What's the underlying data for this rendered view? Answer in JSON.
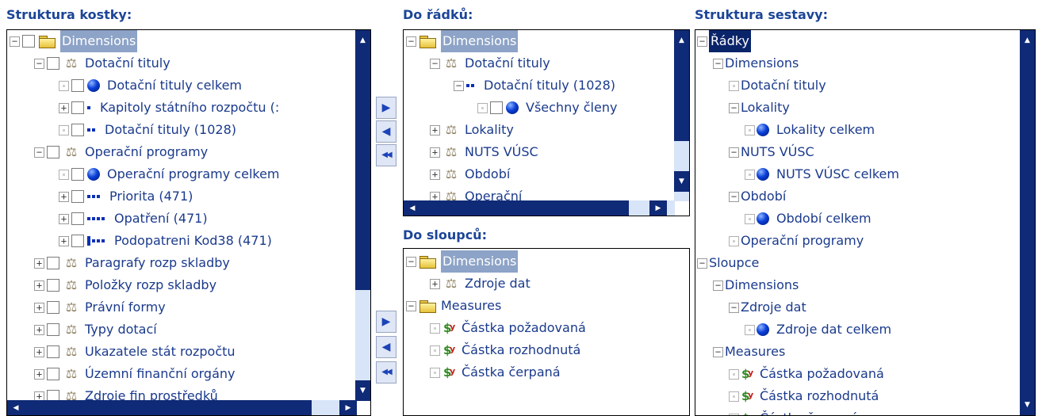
{
  "headers": {
    "cube": "Struktura kostky:",
    "rows": "Do řádků:",
    "cols": "Do sloupců:",
    "report": "Struktura sestavy:"
  },
  "cube_tree": [
    {
      "toggle": "⊟",
      "check": true,
      "icon": "folder",
      "label": "Dimensions",
      "selected": true
    },
    {
      "toggle": "⊟",
      "check": true,
      "icon": "dimension",
      "label": "Dotační tituly"
    },
    {
      "toggle": "dot",
      "check": true,
      "icon": "member-ball",
      "label": "Dotační tituly celkem"
    },
    {
      "toggle": "⊞",
      "check": true,
      "icon": "level-1",
      "label": "Kapitoly státního rozpočtu (:"
    },
    {
      "toggle": "dot",
      "check": true,
      "icon": "level-2",
      "label": "Dotační tituly (1028)"
    },
    {
      "toggle": "⊟",
      "check": true,
      "icon": "dimension",
      "label": "Operační programy"
    },
    {
      "toggle": "dot",
      "check": true,
      "icon": "member-ball",
      "label": "Operační programy celkem"
    },
    {
      "toggle": "⊞",
      "check": true,
      "icon": "level-3",
      "label": "Priorita (471)"
    },
    {
      "toggle": "⊞",
      "check": true,
      "icon": "level-4",
      "label": "Opatření (471)"
    },
    {
      "toggle": "⊞",
      "check": true,
      "icon": "level-podo",
      "label": "Podopatreni Kod38 (471)"
    },
    {
      "toggle": "⊞",
      "check": true,
      "icon": "dimension",
      "label": "Paragrafy rozp skladby"
    },
    {
      "toggle": "⊞",
      "check": true,
      "icon": "dimension",
      "label": "Položky rozp skladby"
    },
    {
      "toggle": "⊞",
      "check": true,
      "icon": "dimension",
      "label": "Právní formy"
    },
    {
      "toggle": "⊞",
      "check": true,
      "icon": "dimension",
      "label": "Typy dotací"
    },
    {
      "toggle": "⊞",
      "check": true,
      "icon": "dimension",
      "label": "Ukazatele stát rozpočtu"
    },
    {
      "toggle": "⊞",
      "check": true,
      "icon": "dimension",
      "label": "Územní finanční orgány"
    },
    {
      "toggle": "⊞",
      "check": true,
      "icon": "dimension",
      "label": "Zdroje fin prostředků"
    }
  ],
  "rows_tree": [
    {
      "toggle": "⊟",
      "check": false,
      "icon": "folder",
      "label": "Dimensions",
      "selected": true
    },
    {
      "toggle": "⊟",
      "check": false,
      "icon": "dimension",
      "label": "Dotační tituly"
    },
    {
      "toggle": "⊟",
      "check": false,
      "icon": "level-2",
      "label": "Dotační tituly (1028)"
    },
    {
      "toggle": "dot",
      "check": true,
      "icon": "member-ball",
      "label": "Všechny členy"
    },
    {
      "toggle": "⊞",
      "check": false,
      "icon": "dimension",
      "label": "Lokality"
    },
    {
      "toggle": "⊞",
      "check": false,
      "icon": "dimension",
      "label": "NUTS VÚSC"
    },
    {
      "toggle": "⊞",
      "check": false,
      "icon": "dimension",
      "label": "Období"
    },
    {
      "toggle": "⊞",
      "check": false,
      "icon": "dimension",
      "label": "Operační"
    }
  ],
  "cols_tree": [
    {
      "toggle": "⊟",
      "check": false,
      "icon": "folder",
      "label": "Dimensions",
      "selected": true
    },
    {
      "toggle": "⊞",
      "check": false,
      "icon": "dimension",
      "label": "Zdroje dat"
    },
    {
      "toggle": "⊟",
      "check": false,
      "icon": "folder",
      "label": "Measures"
    },
    {
      "toggle": "dot",
      "check": false,
      "icon": "measure",
      "label": "Částka požadovaná"
    },
    {
      "toggle": "dot",
      "check": false,
      "icon": "measure",
      "label": "Částka rozhodnutá"
    },
    {
      "toggle": "dot",
      "check": false,
      "icon": "measure",
      "label": "Částka čerpaná"
    }
  ],
  "report_tree": [
    {
      "toggle": "⊟",
      "icon": "",
      "label": "Řádky",
      "selected_dark": true
    },
    {
      "toggle": "⊟",
      "icon": "",
      "label": "Dimensions"
    },
    {
      "toggle": "dot",
      "icon": "",
      "label": "Dotační tituly"
    },
    {
      "toggle": "⊟",
      "icon": "",
      "label": "Lokality"
    },
    {
      "toggle": "dot",
      "icon": "member-ball",
      "label": "Lokality celkem"
    },
    {
      "toggle": "⊟",
      "icon": "",
      "label": "NUTS VÚSC"
    },
    {
      "toggle": "dot",
      "icon": "member-ball",
      "label": "NUTS VÚSC celkem"
    },
    {
      "toggle": "⊟",
      "icon": "",
      "label": "Období"
    },
    {
      "toggle": "dot",
      "icon": "member-ball",
      "label": "Období celkem"
    },
    {
      "toggle": "dot",
      "icon": "",
      "label": "Operační programy"
    },
    {
      "toggle": "⊟",
      "icon": "",
      "label": "Sloupce"
    },
    {
      "toggle": "⊟",
      "icon": "",
      "label": "Dimensions"
    },
    {
      "toggle": "⊟",
      "icon": "",
      "label": "Zdroje dat"
    },
    {
      "toggle": "dot",
      "icon": "member-ball",
      "label": "Zdroje dat celkem"
    },
    {
      "toggle": "⊟",
      "icon": "",
      "label": "Measures"
    },
    {
      "toggle": "dot",
      "icon": "measure",
      "label": "Částka požadovaná"
    },
    {
      "toggle": "dot",
      "icon": "measure",
      "label": "Částka rozhodnutá"
    },
    {
      "toggle": "dot",
      "icon": "measure",
      "label": "Částka čerpaná"
    }
  ],
  "move_buttons": {
    "add": "▶",
    "remove": "◀",
    "remove_all": "◀◀"
  },
  "scroll_arrows": {
    "up": "▲",
    "down": "▼",
    "left": "◀",
    "right": "▶"
  },
  "colors": {
    "header": "#1c4597",
    "tree_text": "#1a3a8c",
    "scrollbar_track": "#d8e4f8",
    "scrollbar_button": "#0f2a76",
    "selection": "#8da3c7",
    "selection_dark": "#0a246a"
  }
}
